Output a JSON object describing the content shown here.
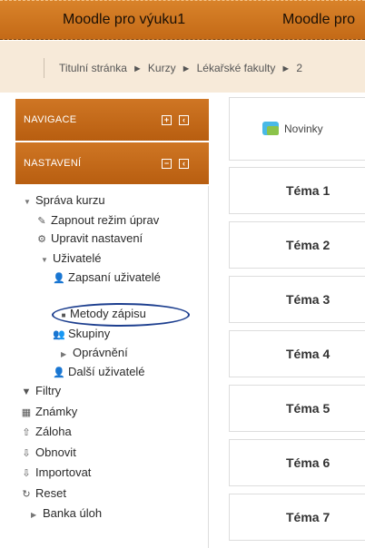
{
  "header": {
    "nav": [
      "Moodle pro výuku1",
      "Moodle pro"
    ]
  },
  "breadcrumb": [
    "Titulní stránka",
    "Kurzy",
    "Lékařské fakulty",
    "2"
  ],
  "blocks": {
    "navigation": {
      "title": "NAVIGACE"
    },
    "settings": {
      "title": "NASTAVENÍ"
    }
  },
  "tree": [
    {
      "label": "Správa kurzu",
      "icon": "triangle-down"
    },
    {
      "label": "Zapnout režim úprav",
      "icon": "pencil-icon"
    },
    {
      "label": "Upravit nastavení",
      "icon": "gear-icon"
    },
    {
      "label": "Uživatelé",
      "icon": "triangle-down"
    },
    {
      "label": "Zapsaní uživatelé",
      "icon": "user-icon"
    },
    {
      "label": "Metody zápisu",
      "icon": "bullet"
    },
    {
      "label": "Skupiny",
      "icon": "group-icon"
    },
    {
      "label": "Oprávnění",
      "icon": "triangle-right"
    },
    {
      "label": "Další uživatelé",
      "icon": "user-icon"
    },
    {
      "label": "Filtry",
      "icon": "filter-icon"
    },
    {
      "label": "Známky",
      "icon": "grades-icon"
    },
    {
      "label": "Záloha",
      "icon": "backup-icon"
    },
    {
      "label": "Obnovit",
      "icon": "restore-icon"
    },
    {
      "label": "Importovat",
      "icon": "import-icon"
    },
    {
      "label": "Reset",
      "icon": "reset-icon"
    },
    {
      "label": "Banka úloh",
      "icon": "triangle-right"
    }
  ],
  "main": {
    "news": "Novinky",
    "topics": [
      "Téma 1",
      "Téma 2",
      "Téma 3",
      "Téma 4",
      "Téma 5",
      "Téma 6",
      "Téma 7"
    ]
  },
  "colors": {
    "accent": "#c96d1b",
    "highlight_oval": "#1d3f8f"
  }
}
